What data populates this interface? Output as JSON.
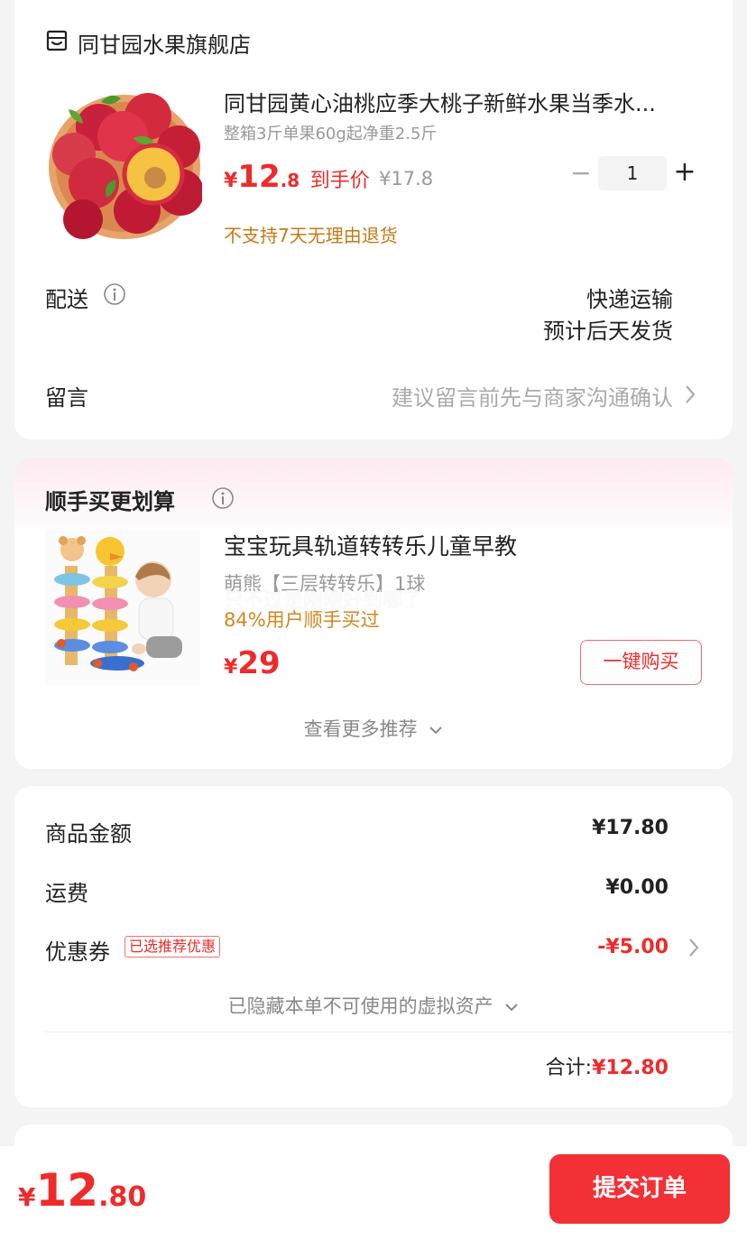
{
  "store": {
    "name": "同甘园水果旗舰店",
    "product": {
      "title": "同甘园黄心油桃应季大桃子新鲜水果当季水...",
      "spec": "整箱3斤单果60g起净重2.5斤",
      "currency": "¥",
      "price_int": "12",
      "price_dec": ".8",
      "price_label": "到手价",
      "original_price": "¥17.8",
      "quantity": "1",
      "return_policy": "不支持7天无理由退货"
    },
    "delivery": {
      "label": "配送",
      "method": "快递运输",
      "eta": "预计后天发货"
    },
    "message": {
      "label": "留言",
      "placeholder": "建议留言前先与商家沟通确认"
    }
  },
  "addon": {
    "title": "顺手买更划算",
    "product": {
      "title": "宝宝玩具轨道转转乐儿童早教",
      "spec": "萌熊【三层转转乐】1球",
      "overlay_text": "只不过是刚刚好到哪了",
      "social_proof": "84%用户顺手买过",
      "currency": "¥",
      "price": "29",
      "buy_label": "一键购买"
    },
    "more_label": "查看更多推荐"
  },
  "summary": {
    "goods_label": "商品金额",
    "goods_value": "¥17.80",
    "shipping_label": "运费",
    "shipping_value": "¥0.00",
    "coupon_label": "优惠券",
    "coupon_tag": "已选推荐优惠",
    "coupon_value": "-¥5.00",
    "hidden_assets": "已隐藏本单不可使用的虚拟资产",
    "total_label": "合计:",
    "total_value": "¥12.80"
  },
  "bottom_bar": {
    "currency": "¥",
    "amount_int": "12",
    "amount_dec": ".80",
    "submit_label": "提交订单"
  },
  "colors": {
    "accent_red": "#ee2b2b",
    "orange_text": "#c77a14",
    "submit_button": "#f23035"
  }
}
